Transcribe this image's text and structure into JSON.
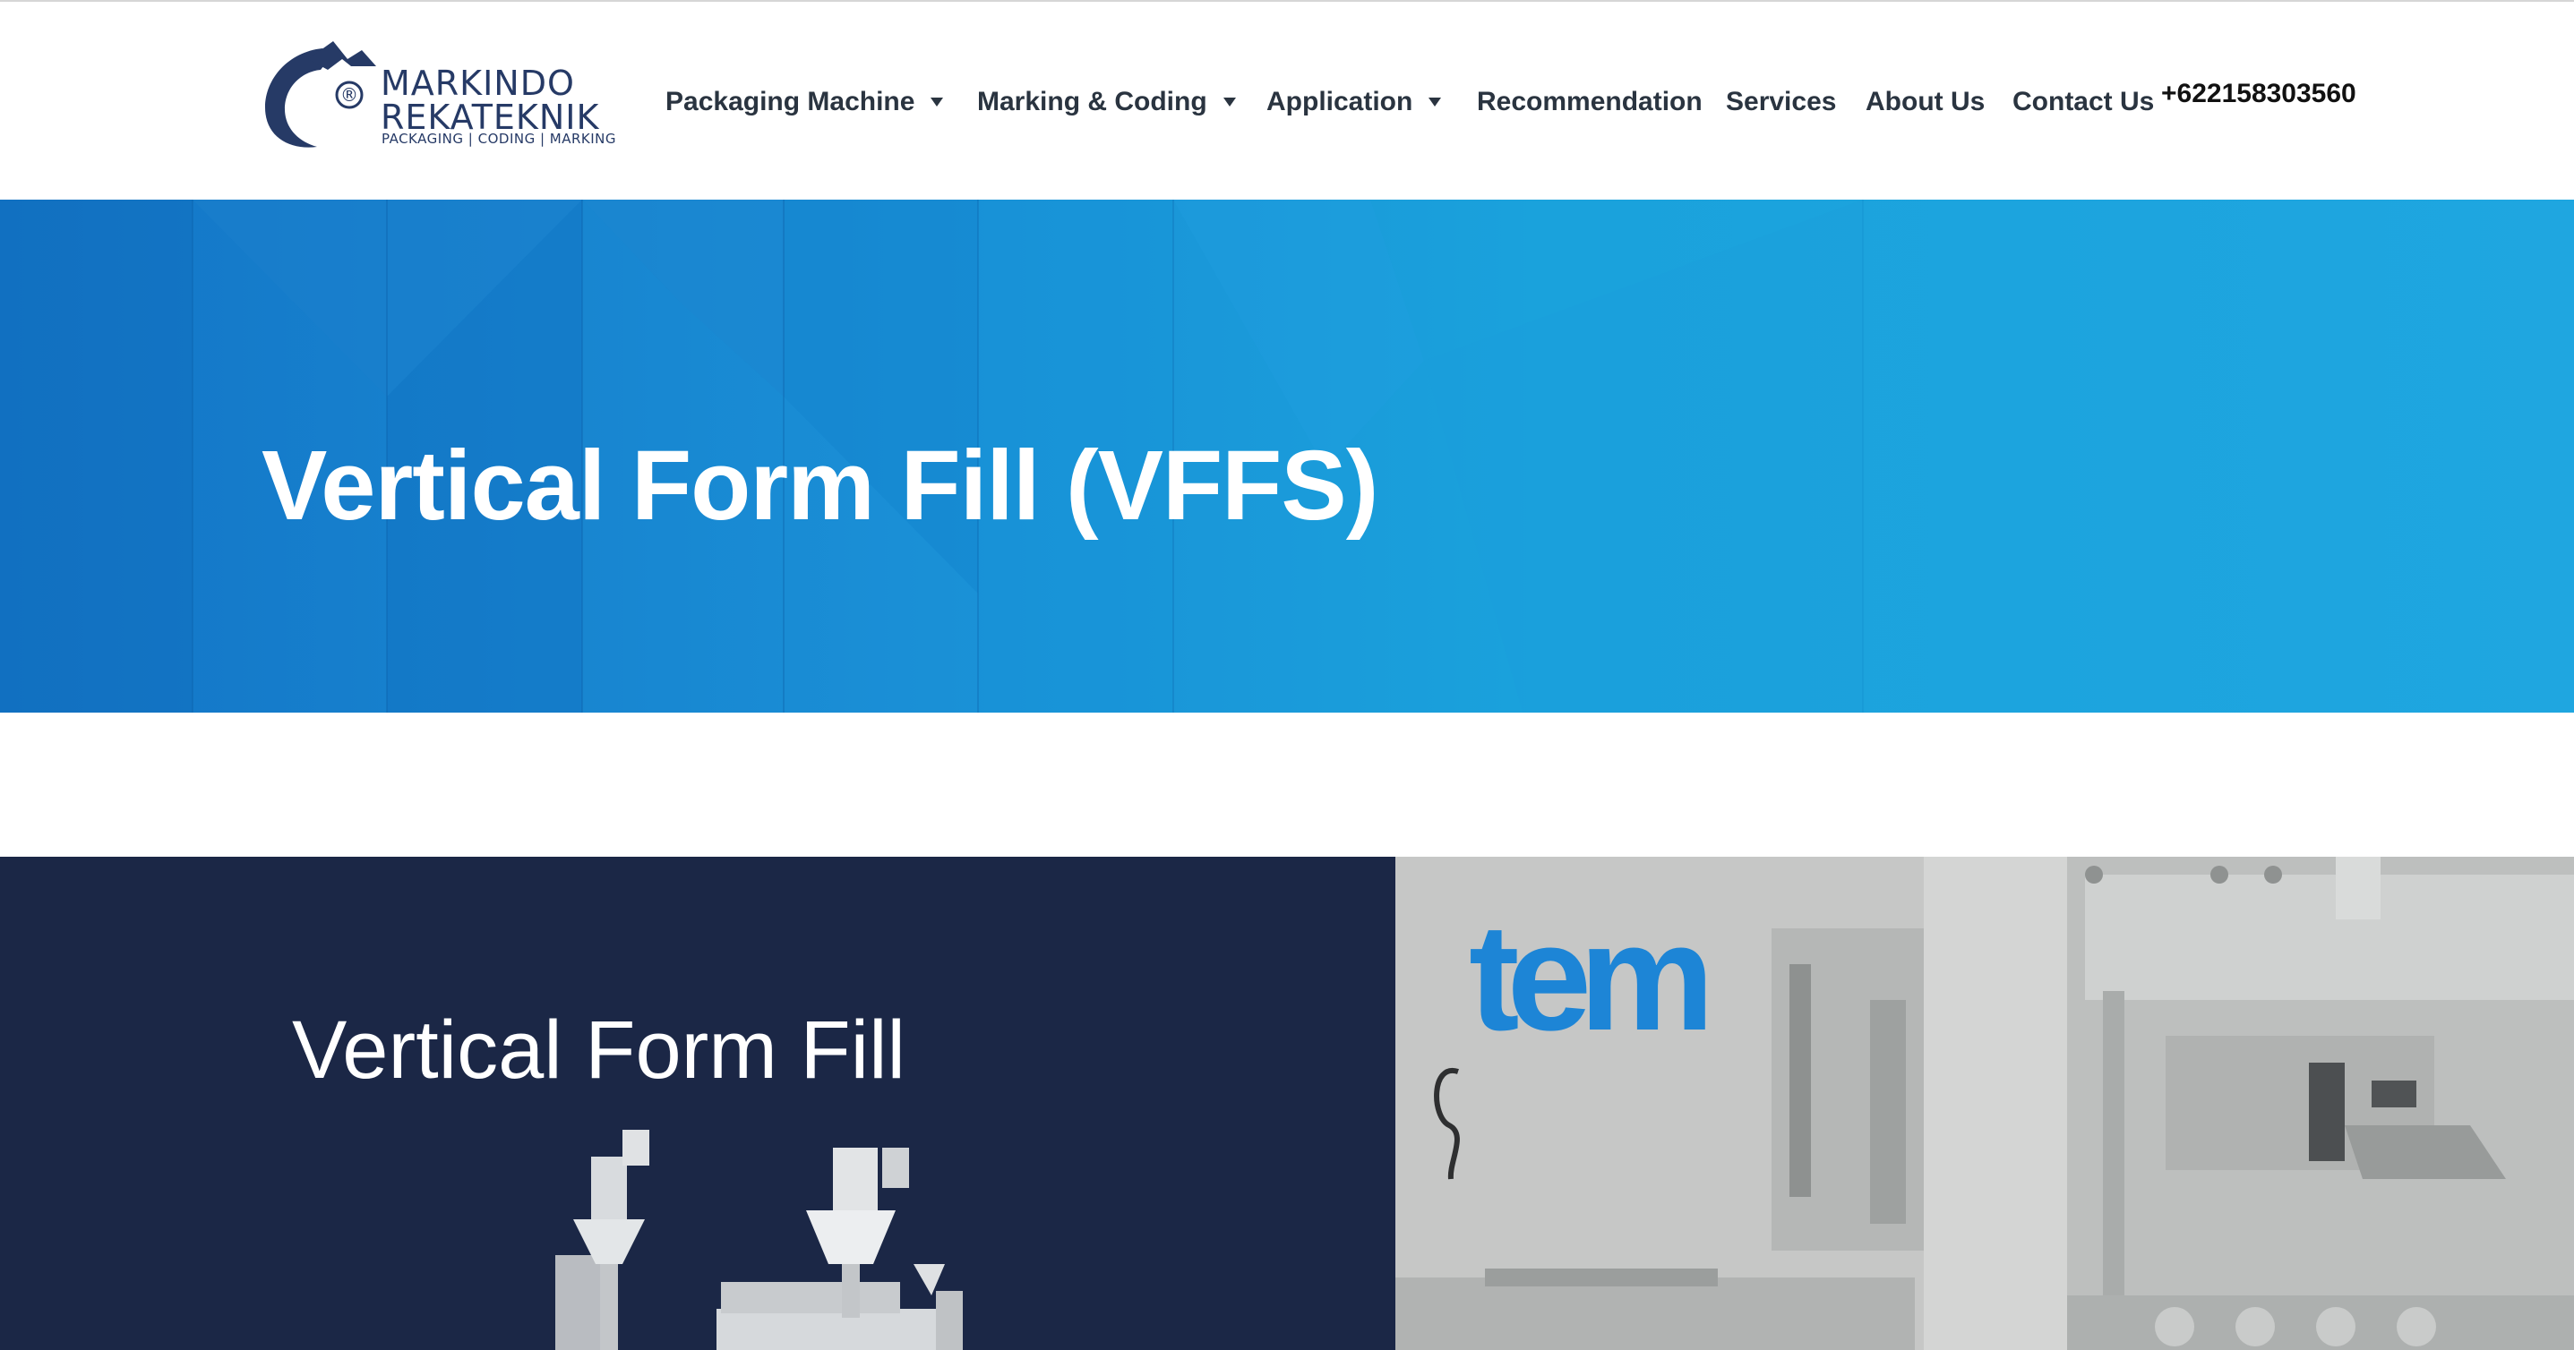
{
  "brand": {
    "line1": "MARKINDO",
    "line2": "REKATEKNIK",
    "tagline": "PACKAGING | CODING | MARKING",
    "registered_mark": "®"
  },
  "nav": {
    "items": [
      {
        "label": "Packaging Machine",
        "has_dropdown": true
      },
      {
        "label": "Marking & Coding",
        "has_dropdown": true
      },
      {
        "label": "Application",
        "has_dropdown": true
      },
      {
        "label": "Recommendation",
        "has_dropdown": false
      },
      {
        "label": "Services",
        "has_dropdown": false
      },
      {
        "label": "About Us",
        "has_dropdown": false
      },
      {
        "label": "Contact Us",
        "has_dropdown": false
      }
    ],
    "phone": "+622158303560"
  },
  "hero": {
    "title": "Vertical Form Fill (VFFS)"
  },
  "section": {
    "title": "Vertical Form Fill"
  },
  "video": {
    "logo_text": "tem"
  },
  "colors": {
    "brand_navy": "#263a66",
    "nav_text": "#2a3440",
    "hero_blue": "#1a8fd6",
    "dark_panel": "#1b2746",
    "tem_blue": "#1d85d6"
  },
  "icons": [
    "brand-logo-icon",
    "chevron-down-icon"
  ]
}
